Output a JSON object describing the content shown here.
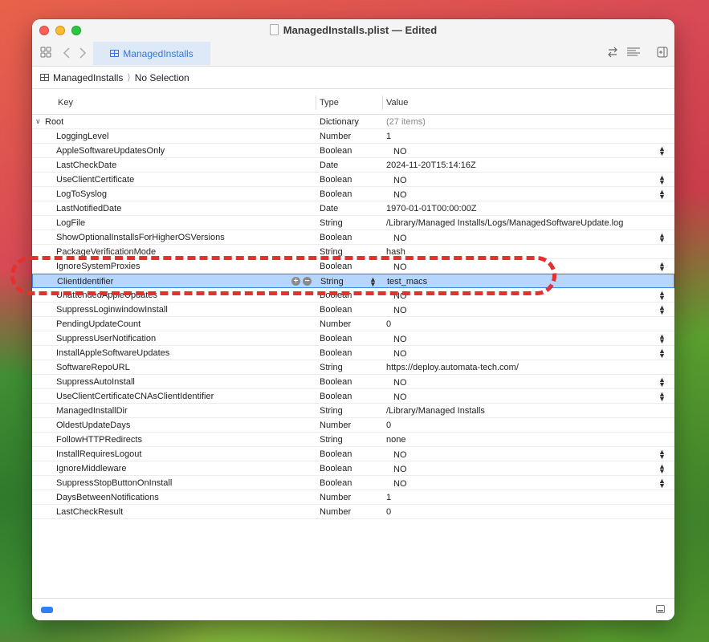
{
  "window": {
    "title": "ManagedInstalls.plist — Edited"
  },
  "toolbar": {
    "tab_label": "ManagedInstalls"
  },
  "breadcrumb": {
    "root": "ManagedInstalls",
    "selection": "No Selection"
  },
  "columns": {
    "key": "Key",
    "type": "Type",
    "value": "Value"
  },
  "root": {
    "key": "Root",
    "type": "Dictionary",
    "value": "(27 items)"
  },
  "rows": [
    {
      "key": "LoggingLevel",
      "type": "Number",
      "value": "1"
    },
    {
      "key": "AppleSoftwareUpdatesOnly",
      "type": "Boolean",
      "value": "NO"
    },
    {
      "key": "LastCheckDate",
      "type": "Date",
      "value": "2024-11-20T15:14:16Z"
    },
    {
      "key": "UseClientCertificate",
      "type": "Boolean",
      "value": "NO"
    },
    {
      "key": "LogToSyslog",
      "type": "Boolean",
      "value": "NO"
    },
    {
      "key": "LastNotifiedDate",
      "type": "Date",
      "value": "1970-01-01T00:00:00Z"
    },
    {
      "key": "LogFile",
      "type": "String",
      "value": "/Library/Managed Installs/Logs/ManagedSoftwareUpdate.log"
    },
    {
      "key": "ShowOptionalInstallsForHigherOSVersions",
      "type": "Boolean",
      "value": "NO"
    },
    {
      "key": "PackageVerificationMode",
      "type": "String",
      "value": "hash"
    },
    {
      "key": "IgnoreSystemProxies",
      "type": "Boolean",
      "value": "NO"
    },
    {
      "key": "ClientIdentifier",
      "type": "String",
      "value": "test_macs"
    },
    {
      "key": "UnattendedAppleUpdates",
      "type": "Boolean",
      "value": "NO"
    },
    {
      "key": "SuppressLoginwindowInstall",
      "type": "Boolean",
      "value": "NO"
    },
    {
      "key": "PendingUpdateCount",
      "type": "Number",
      "value": "0"
    },
    {
      "key": "SuppressUserNotification",
      "type": "Boolean",
      "value": "NO"
    },
    {
      "key": "InstallAppleSoftwareUpdates",
      "type": "Boolean",
      "value": "NO"
    },
    {
      "key": "SoftwareRepoURL",
      "type": "String",
      "value": "https://deploy.automata-tech.com/"
    },
    {
      "key": "SuppressAutoInstall",
      "type": "Boolean",
      "value": "NO"
    },
    {
      "key": "UseClientCertificateCNAsClientIdentifier",
      "type": "Boolean",
      "value": "NO"
    },
    {
      "key": "ManagedInstallDir",
      "type": "String",
      "value": "/Library/Managed Installs"
    },
    {
      "key": "OldestUpdateDays",
      "type": "Number",
      "value": "0"
    },
    {
      "key": "FollowHTTPRedirects",
      "type": "String",
      "value": "none"
    },
    {
      "key": "InstallRequiresLogout",
      "type": "Boolean",
      "value": "NO"
    },
    {
      "key": "IgnoreMiddleware",
      "type": "Boolean",
      "value": "NO"
    },
    {
      "key": "SuppressStopButtonOnInstall",
      "type": "Boolean",
      "value": "NO"
    },
    {
      "key": "DaysBetweenNotifications",
      "type": "Number",
      "value": "1"
    },
    {
      "key": "LastCheckResult",
      "type": "Number",
      "value": "0"
    }
  ],
  "selected_index": 10,
  "icons": {
    "sidebar": "sidebar-grid-icon",
    "back": "chevron-left-icon",
    "forward": "chevron-right-icon",
    "swap": "arrows-swap-icon",
    "list": "lines-icon",
    "inspector": "inspector-panel-icon"
  },
  "colors": {
    "selection": "#b6d6fb",
    "accent": "#3478d6",
    "annotation": "#e53030"
  }
}
